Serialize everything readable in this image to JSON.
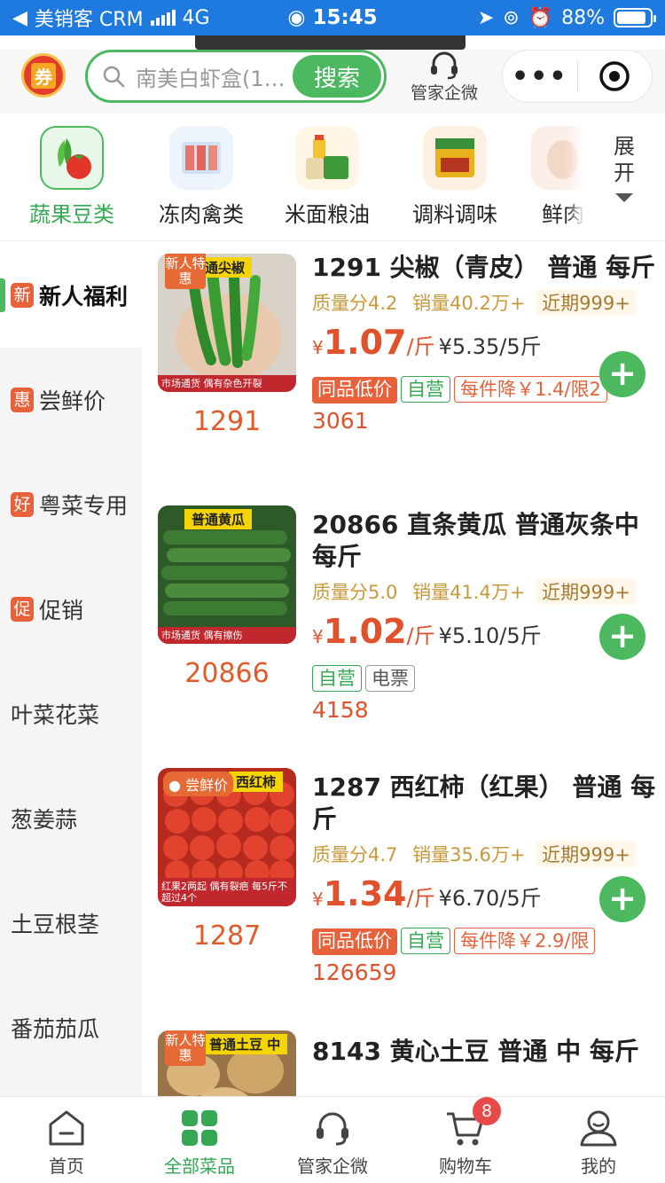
{
  "status_bar": {
    "app_name": "美销客 CRM",
    "network": "4G",
    "time": "15:45",
    "battery": "88%",
    "battery_level": 0.88
  },
  "header": {
    "coupon_label": "券",
    "search_placeholder": "南美白虾盒(1....",
    "search_button": "搜索",
    "manager_label": "管家企微"
  },
  "categories": [
    {
      "label": "蔬果豆类",
      "active": true
    },
    {
      "label": "冻肉禽类",
      "active": false
    },
    {
      "label": "米面粮油",
      "active": false
    },
    {
      "label": "调料调味",
      "active": false
    },
    {
      "label": "鲜肉",
      "active": false
    }
  ],
  "expand_label": "展开",
  "sidebar": [
    {
      "badge": "新",
      "label": "新人福利",
      "badge_color": "#e7613b"
    },
    {
      "badge": "惠",
      "label": "尝鲜价",
      "badge_color": "#e7613b"
    },
    {
      "badge": "好",
      "label": "粤菜专用",
      "badge_color": "#e7613b"
    },
    {
      "badge": "促",
      "label": "促销",
      "badge_color": "#e7613b"
    },
    {
      "badge": "",
      "label": "叶菜花菜"
    },
    {
      "badge": "",
      "label": "葱姜蒜"
    },
    {
      "badge": "",
      "label": "土豆根茎"
    },
    {
      "badge": "",
      "label": "番茄茄瓜"
    }
  ],
  "products": [
    {
      "code": "1291",
      "title": "1291 尖椒（青皮） 普通 每斤",
      "quality": "质量分4.2",
      "sales": "销量40.2万+",
      "near": "近期999+",
      "currency": "¥",
      "price": "1.07",
      "unit": "/斤",
      "pack_price": "¥5.35/5斤",
      "tags": [
        "同品低价",
        "自营",
        "每件降￥1.4/限2"
      ],
      "sold": "3061",
      "ribbon": "新人特惠",
      "img_tag": "普通尖椒",
      "img_caption": "市场通货 偶有杂色开裂"
    },
    {
      "code": "20866",
      "title": "20866 直条黄瓜 普通灰条中 每斤",
      "quality": "质量分5.0",
      "sales": "销量41.4万+",
      "near": "近期999+",
      "currency": "¥",
      "price": "1.02",
      "unit": "/斤",
      "pack_price": "¥5.10/5斤",
      "tags": [
        "自营",
        "电票"
      ],
      "sold": "4158",
      "img_tag": "普通黄瓜",
      "img_caption": "市场通货 偶有擦伤"
    },
    {
      "code": "1287",
      "title": "1287 西红柿（红果） 普通 每斤",
      "quality": "质量分4.7",
      "sales": "销量35.6万+",
      "near": "近期999+",
      "currency": "¥",
      "price": "1.34",
      "unit": "/斤",
      "pack_price": "¥6.70/5斤",
      "tags": [
        "同品低价",
        "自营",
        "每件降￥2.9/限"
      ],
      "sold": "126659",
      "ribbon2": "尝鲜价",
      "img_tag": "西红柿",
      "img_caption": "红果2两起 偶有裂疤 每5斤不超过4个"
    },
    {
      "title": "8143 黄心土豆 普通 中 每斤",
      "ribbon": "新人特惠",
      "img_tag": "普通土豆 中"
    }
  ],
  "tabbar": [
    {
      "label": "首页",
      "active": false
    },
    {
      "label": "全部菜品",
      "active": true
    },
    {
      "label": "管家企微",
      "active": false
    },
    {
      "label": "购物车",
      "active": false,
      "badge": "8"
    },
    {
      "label": "我的",
      "active": false
    }
  ]
}
